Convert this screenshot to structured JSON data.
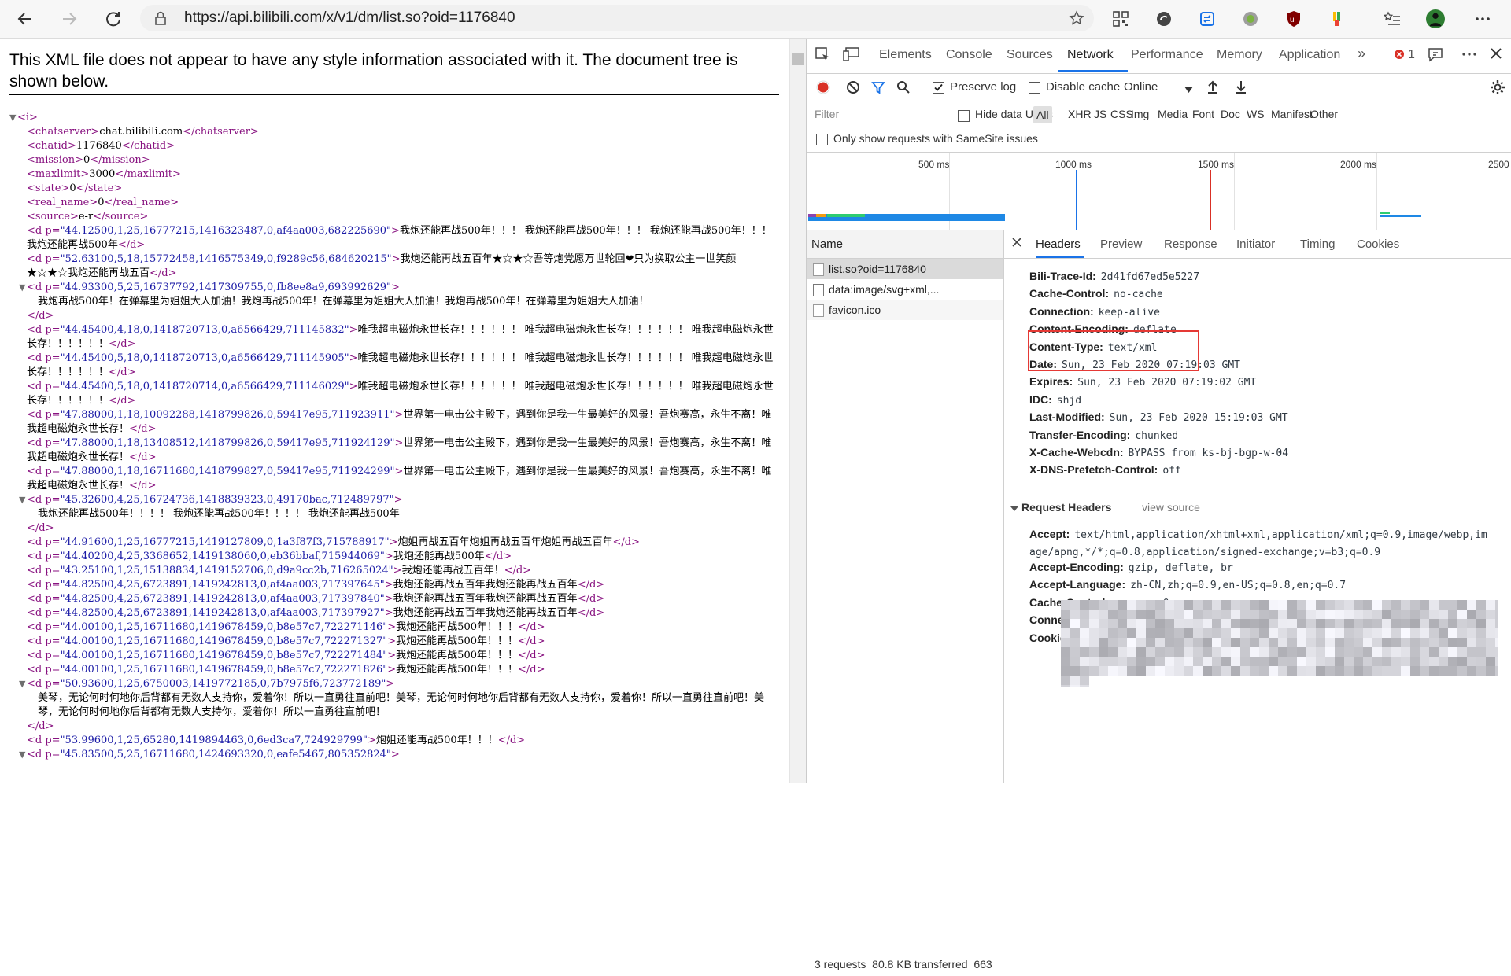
{
  "browser": {
    "url": "https://api.bilibili.com/x/v1/dm/list.so?oid=1176840"
  },
  "page": {
    "xml_note": "This XML file does not appear to have any style information associated with it. The document tree is shown below.",
    "xml_lines": [
      {
        "type": "root",
        "text": "<i>"
      },
      {
        "type": "plain",
        "text": "<chatserver>chat.bilibili.com</chatserver>"
      },
      {
        "type": "plain",
        "text": "<chatid>1176840</chatid>"
      },
      {
        "type": "plain",
        "text": "<mission>0</mission>"
      },
      {
        "type": "plain",
        "text": "<maxlimit>3000</maxlimit>"
      },
      {
        "type": "plain",
        "text": "<state>0</state>"
      },
      {
        "type": "plain",
        "text": "<real_name>0</real_name>"
      },
      {
        "type": "plain",
        "text": "<source>e-r</source>"
      },
      {
        "type": "d",
        "attr": "44.12500,1,25,16777215,1416323487,0,af4aa003,682225690",
        "text": "我炮还能再战500年！！！ 我炮还能再战500年！！！ 我炮还能再战500年！！！ 我炮还能再战500年",
        "wrap": true
      },
      {
        "type": "d",
        "attr": "52.63100,5,18,15772458,1416575349,0,f9289c56,684620215",
        "text": "我炮还能再战五百年★☆★☆吾等炮党愿万世轮回❤只为换取公主一世笑颜★☆★☆我炮还能再战五百",
        "wrap": true
      },
      {
        "type": "dblock",
        "attr": "44.93300,5,25,16737792,1417309755,0,fb8ee8a9,693992629",
        "text": "我炮再战500年！在弹幕里为姐姐大人加油！我炮再战500年！在弹幕里为姐姐大人加油！我炮再战500年！在弹幕里为姐姐大人加油！"
      },
      {
        "type": "d",
        "attr": "44.45400,4,18,0,1418720713,0,a6566429,711145832",
        "text": "唯我超电磁炮永世长存！！！！！！ 唯我超电磁炮永世长存！！！！！！ 唯我超电磁炮永世长存！！！！！！",
        "wrap": true
      },
      {
        "type": "d",
        "attr": "44.45400,5,18,0,1418720713,0,a6566429,711145905",
        "text": "唯我超电磁炮永世长存！！！！！！ 唯我超电磁炮永世长存！！！！！！ 唯我超电磁炮永世长存！！！！！！",
        "wrap": true
      },
      {
        "type": "d",
        "attr": "44.45400,5,18,0,1418720714,0,a6566429,711146029",
        "text": "唯我超电磁炮永世长存！！！！！！ 唯我超电磁炮永世长存！！！！！！ 唯我超电磁炮永世长存！！！！！！",
        "wrap": true
      },
      {
        "type": "d",
        "attr": "47.88000,1,18,10092288,1418799826,0,59417e95,711923911",
        "text": "世界第一电击公主殿下，遇到你是我一生最美好的风景！吾炮赛高，永生不离！唯我超电磁炮永世长存！",
        "wrap": true
      },
      {
        "type": "d",
        "attr": "47.88000,1,18,13408512,1418799826,0,59417e95,711924129",
        "text": "世界第一电击公主殿下，遇到你是我一生最美好的风景！吾炮赛高，永生不离！唯我超电磁炮永世长存！",
        "wrap": true
      },
      {
        "type": "d",
        "attr": "47.88000,1,18,16711680,1418799827,0,59417e95,711924299",
        "text": "世界第一电击公主殿下，遇到你是我一生最美好的风景！吾炮赛高，永生不离！唯我超电磁炮永世长存！",
        "wrap": true
      },
      {
        "type": "dblock",
        "attr": "45.32600,4,25,16724736,1418839323,0,49170bac,712489797",
        "text": "我炮还能再战500年！！！！ 我炮还能再战500年！！！！ 我炮还能再战500年"
      },
      {
        "type": "d",
        "attr": "44.91600,1,25,16777215,1419127809,0,1a3f87f3,715788917",
        "text": "炮姐再战五百年炮姐再战五百年炮姐再战五百年"
      },
      {
        "type": "d",
        "attr": "44.40200,4,25,3368652,1419138060,0,eb36bbaf,715944069",
        "text": "我炮还能再战500年"
      },
      {
        "type": "d",
        "attr": "43.25100,1,25,15138834,1419152706,0,d9a9cc2b,716265024",
        "text": "我炮还能再战五百年！"
      },
      {
        "type": "d",
        "attr": "44.82500,4,25,6723891,1419242813,0,af4aa003,717397645",
        "text": "我炮还能再战五百年我炮还能再战五百年"
      },
      {
        "type": "d",
        "attr": "44.82500,4,25,6723891,1419242813,0,af4aa003,717397840",
        "text": "我炮还能再战五百年我炮还能再战五百年"
      },
      {
        "type": "d",
        "attr": "44.82500,4,25,6723891,1419242813,0,af4aa003,717397927",
        "text": "我炮还能再战五百年我炮还能再战五百年"
      },
      {
        "type": "d",
        "attr": "44.00100,1,25,16711680,1419678459,0,b8e57c7,722271146",
        "text": "我炮还能再战500年！！！"
      },
      {
        "type": "d",
        "attr": "44.00100,1,25,16711680,1419678459,0,b8e57c7,722271327",
        "text": "我炮还能再战500年！！！"
      },
      {
        "type": "d",
        "attr": "44.00100,1,25,16711680,1419678459,0,b8e57c7,722271484",
        "text": "我炮还能再战500年！！！"
      },
      {
        "type": "d",
        "attr": "44.00100,1,25,16711680,1419678459,0,b8e57c7,722271826",
        "text": "我炮还能再战500年！！！"
      },
      {
        "type": "dblock",
        "attr": "50.93600,1,25,6750003,1419772185,0,7b7975f6,723772189",
        "text": "美琴，无论何时何地你后背都有无数人支持你，爱着你！所以一直勇往直前吧！美琴，无论何时何地你后背都有无数人支持你，爱着你！所以一直勇往直前吧！美琴，无论何时何地你后背都有无数人支持你，爱着你！所以一直勇往直前吧！"
      },
      {
        "type": "d",
        "attr": "53.99600,1,25,65280,1419894463,0,6ed3ca7,724929799",
        "text": "炮姐还能再战500年！！！"
      },
      {
        "type": "dopen",
        "attr": "45.83500,5,25,16711680,1424693320,0,eafe5467,805352824"
      }
    ]
  },
  "devtools": {
    "tabs": [
      "Elements",
      "Console",
      "Sources",
      "Network",
      "Performance",
      "Memory",
      "Application"
    ],
    "active_tab": "Network",
    "error_count": "1",
    "toolbar": {
      "preserve_log": "Preserve log",
      "disable_cache": "Disable cache",
      "throttle": "Online"
    },
    "filter": {
      "placeholder": "Filter",
      "hide_data_urls": "Hide data URLs",
      "types": [
        "All",
        "XHR",
        "JS",
        "CSS",
        "Img",
        "Media",
        "Font",
        "Doc",
        "WS",
        "Manifest",
        "Other"
      ],
      "samesite": "Only show requests with SameSite issues"
    },
    "waterfall_ticks": [
      "500 ms",
      "1000 ms",
      "1500 ms",
      "2000 ms",
      "2500"
    ],
    "requests": {
      "header": "Name",
      "items": [
        "list.so?oid=1176840",
        "data:image/svg+xml,...",
        "favicon.ico"
      ],
      "status": "3 requests  80.8 KB transferred  663"
    },
    "detail_tabs": [
      "Headers",
      "Preview",
      "Response",
      "Initiator",
      "Timing",
      "Cookies"
    ],
    "response_headers": [
      {
        "k": "Bili-Trace-Id:",
        "v": "2d41fd67ed5e5227"
      },
      {
        "k": "Cache-Control:",
        "v": "no-cache"
      },
      {
        "k": "Connection:",
        "v": "keep-alive"
      },
      {
        "k": "Content-Encoding:",
        "v": "deflate"
      },
      {
        "k": "Content-Type:",
        "v": "text/xml"
      },
      {
        "k": "Date:",
        "v": "Sun, 23 Feb 2020 07:19:03 GMT"
      },
      {
        "k": "Expires:",
        "v": "Sun, 23 Feb 2020 07:19:02 GMT"
      },
      {
        "k": "IDC:",
        "v": "shjd"
      },
      {
        "k": "Last-Modified:",
        "v": "Sun, 23 Feb 2020 15:19:03 GMT"
      },
      {
        "k": "Transfer-Encoding:",
        "v": "chunked"
      },
      {
        "k": "X-Cache-Webcdn:",
        "v": "BYPASS from ks-bj-bgp-w-04"
      },
      {
        "k": "X-DNS-Prefetch-Control:",
        "v": "off"
      }
    ],
    "request_headers_title": "Request Headers",
    "view_source": "view source",
    "request_headers": [
      {
        "k": "Accept:",
        "v": "text/html,application/xhtml+xml,application/xml;q=0.9,image/webp,image/apng,*/*;q=0.8,application/signed-exchange;v=b3;q=0.9",
        "wrap": true
      },
      {
        "k": "Accept-Encoding:",
        "v": "gzip, deflate, br"
      },
      {
        "k": "Accept-Language:",
        "v": "zh-CN,zh;q=0.9,en-US;q=0.8,en;q=0.7"
      },
      {
        "k": "Cache-Control:",
        "v": "max-age=0"
      },
      {
        "k": "Connection:",
        "v": "keep-alive"
      },
      {
        "k": "Cookie:",
        "v": ""
      }
    ],
    "colors": {
      "accent": "#1a73e8",
      "highlight_box": "#e53935",
      "record": "#d93025"
    }
  }
}
